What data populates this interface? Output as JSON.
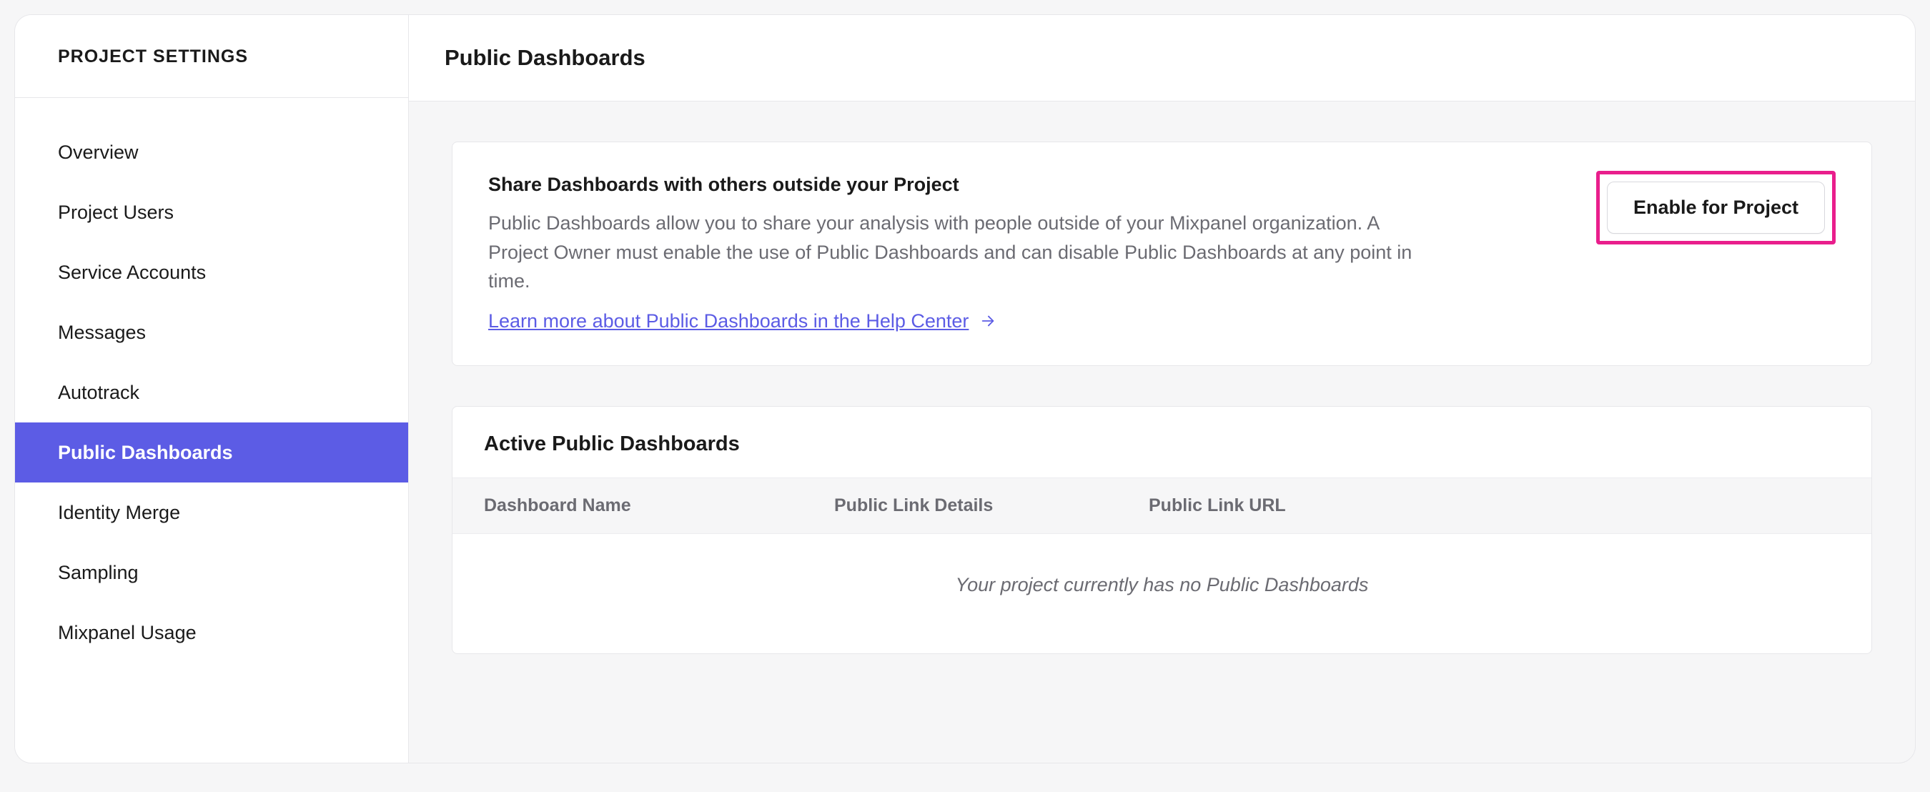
{
  "sidebar": {
    "title": "PROJECT SETTINGS",
    "items": [
      {
        "label": "Overview",
        "active": false
      },
      {
        "label": "Project Users",
        "active": false
      },
      {
        "label": "Service Accounts",
        "active": false
      },
      {
        "label": "Messages",
        "active": false
      },
      {
        "label": "Autotrack",
        "active": false
      },
      {
        "label": "Public Dashboards",
        "active": true
      },
      {
        "label": "Identity Merge",
        "active": false
      },
      {
        "label": "Sampling",
        "active": false
      },
      {
        "label": "Mixpanel Usage",
        "active": false
      }
    ]
  },
  "header": {
    "page_title": "Public Dashboards"
  },
  "info_card": {
    "heading": "Share Dashboards with others outside your Project",
    "body": "Public Dashboards allow you to share your analysis with people outside of your Mixpanel organization. A Project Owner must enable the use of Public Dashboards and can disable Public Dashboards at any point in time.",
    "learn_more": "Learn more about Public Dashboards in the Help Center",
    "enable_button": "Enable for Project"
  },
  "list_card": {
    "title": "Active Public Dashboards",
    "columns": {
      "name": "Dashboard Name",
      "details": "Public Link Details",
      "url": "Public Link URL"
    },
    "empty": "Your project currently has no Public Dashboards"
  },
  "colors": {
    "accent": "#5c5ce5",
    "highlight": "#e91e8c"
  }
}
